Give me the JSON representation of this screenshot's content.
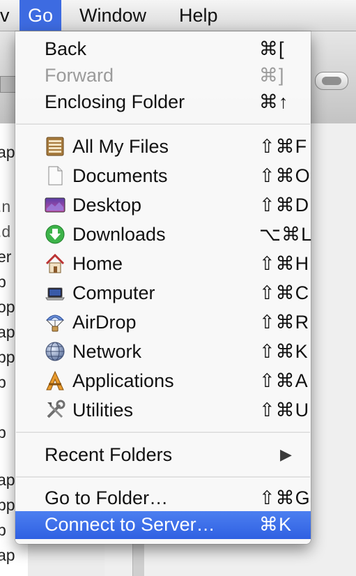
{
  "menubar": {
    "items": [
      {
        "label": "v"
      },
      {
        "label": "Go"
      },
      {
        "label": "Window"
      },
      {
        "label": "Help"
      }
    ]
  },
  "finder_list_fragments": [
    "ap",
    ".n",
    ".d",
    "er",
    "p",
    "op",
    "ap",
    "pp",
    "p",
    "p",
    "ap",
    "pp",
    "p",
    "ap",
    "p"
  ],
  "go_menu": {
    "back": {
      "label": "Back",
      "shortcut": "⌘["
    },
    "forward": {
      "label": "Forward",
      "shortcut": "⌘]",
      "disabled": true
    },
    "enclosing": {
      "label": "Enclosing Folder",
      "shortcut": "⌘↑"
    },
    "places": [
      {
        "label": "All My Files",
        "shortcut": "⇧⌘F",
        "icon": "all-my-files-icon"
      },
      {
        "label": "Documents",
        "shortcut": "⇧⌘O",
        "icon": "documents-icon"
      },
      {
        "label": "Desktop",
        "shortcut": "⇧⌘D",
        "icon": "desktop-icon"
      },
      {
        "label": "Downloads",
        "shortcut": "⌥⌘L",
        "icon": "downloads-icon"
      },
      {
        "label": "Home",
        "shortcut": "⇧⌘H",
        "icon": "home-icon"
      },
      {
        "label": "Computer",
        "shortcut": "⇧⌘C",
        "icon": "computer-icon"
      },
      {
        "label": "AirDrop",
        "shortcut": "⇧⌘R",
        "icon": "airdrop-icon"
      },
      {
        "label": "Network",
        "shortcut": "⇧⌘K",
        "icon": "network-icon"
      },
      {
        "label": "Applications",
        "shortcut": "⇧⌘A",
        "icon": "applications-icon"
      },
      {
        "label": "Utilities",
        "shortcut": "⇧⌘U",
        "icon": "utilities-icon"
      }
    ],
    "recent": {
      "label": "Recent Folders",
      "submenu_arrow": "▶"
    },
    "goto_folder": {
      "label": "Go to Folder…",
      "shortcut": "⇧⌘G"
    },
    "connect": {
      "label": "Connect to Server…",
      "shortcut": "⌘K",
      "selected": true
    }
  },
  "colors": {
    "menu_highlight": "#3d6be1",
    "menu_background": "#f8f8f8",
    "disabled_text": "#9b9b9b"
  }
}
